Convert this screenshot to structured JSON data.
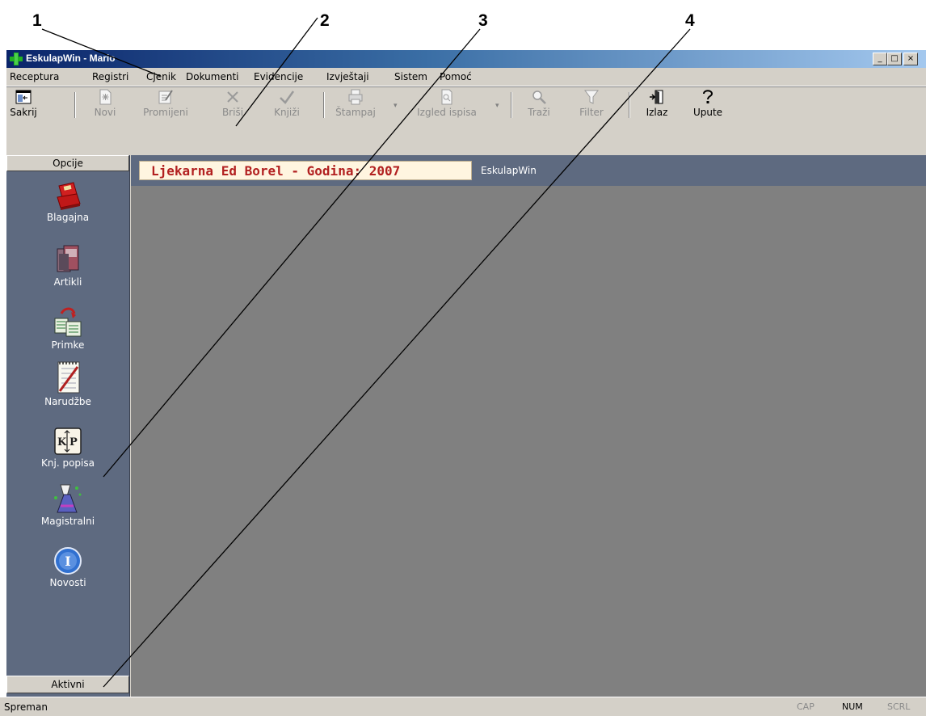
{
  "callouts": [
    "1",
    "2",
    "3",
    "4"
  ],
  "window": {
    "title": "EskulapWin - Mario",
    "buttons": [
      "_",
      "□",
      "×"
    ]
  },
  "menu": [
    "Receptura",
    "Registri",
    "Cjenik",
    "Dokumenti",
    "Evidencije",
    "Izvještaji",
    "Sistem",
    "Pomoć"
  ],
  "toolbar": {
    "sakrij": "Sakrij",
    "novi": "Novi",
    "promijeni": "Promijeni",
    "brisi": "Briši",
    "knjizi": "Knjiži",
    "stampaj": "Štampaj",
    "izgled": "Izgled ispisa",
    "trazi": "Traži",
    "filter": "Filter",
    "izlaz": "Izlaz",
    "upute": "Upute"
  },
  "sidebar": {
    "header": "Opcije",
    "footer": "Aktivni",
    "items": [
      "Blagajna",
      "Artikli",
      "Primke",
      "Narudžbe",
      "Knj. popisa",
      "Magistralni",
      "Novosti"
    ]
  },
  "main": {
    "banner": "Ljekarna Ed Borel - Godina: 2007",
    "label": "EskulapWin"
  },
  "status": {
    "text": "Spreman",
    "cap": "CAP",
    "num": "NUM",
    "scrl": "SCRL"
  },
  "colors": {
    "titlebar": "#0a246a",
    "sidebar": "#5e6a80",
    "workspace": "#808080",
    "banner_text": "#b22020"
  }
}
